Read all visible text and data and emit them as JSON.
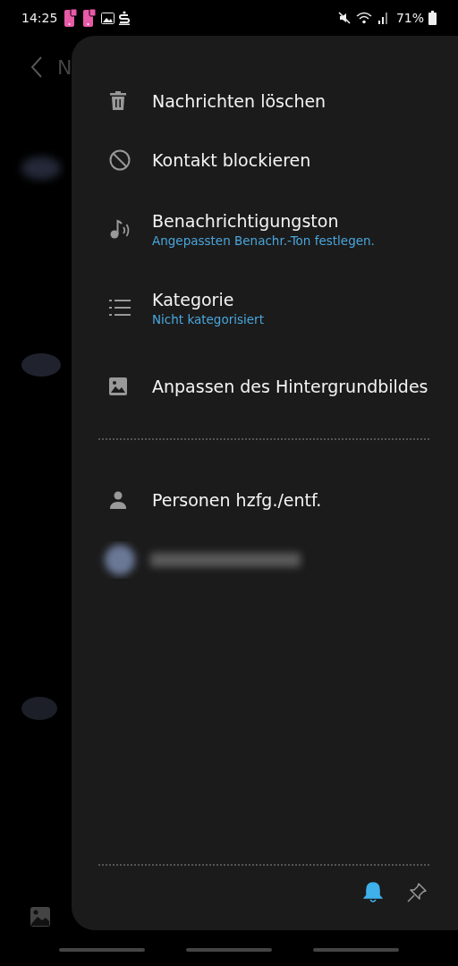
{
  "status_bar": {
    "time": "14:25",
    "battery": "71%"
  },
  "background": {
    "title": "N"
  },
  "menu": {
    "items": [
      {
        "title": "Nachrichten löschen"
      },
      {
        "title": "Kontakt blockieren"
      },
      {
        "title": "Benachrichtigungston",
        "subtitle": "Angepassten Benachr.-Ton festlegen."
      },
      {
        "title": "Kategorie",
        "subtitle": "Nicht kategorisiert"
      },
      {
        "title": "Anpassen des Hintergrundbildes"
      }
    ],
    "people": {
      "title": "Personen hzfg./entf."
    },
    "footer": {
      "notifications_on": true,
      "pinned": false
    }
  }
}
